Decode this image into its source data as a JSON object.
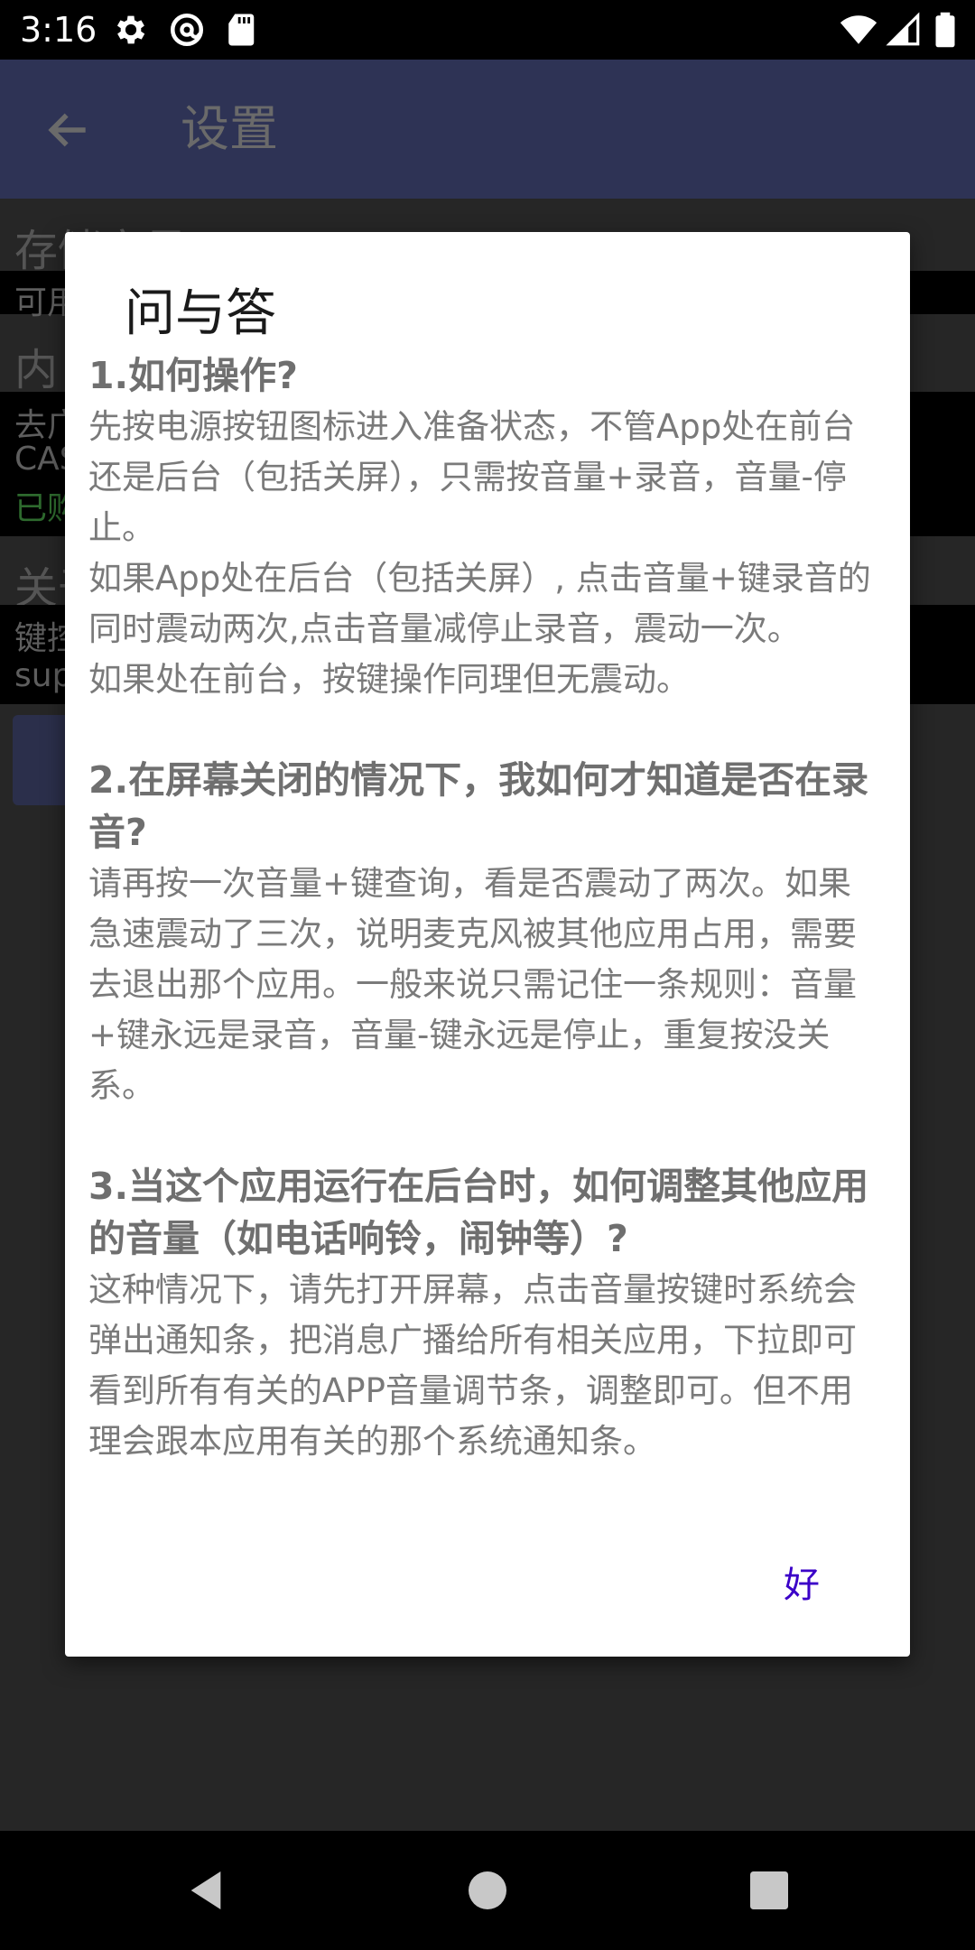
{
  "status_bar": {
    "time": "3:16",
    "icons": [
      "gear-icon",
      "at-sign-icon",
      "sd-card-icon",
      "wifi-icon",
      "cell-signal-icon",
      "battery-icon"
    ]
  },
  "app_bar": {
    "title": "设置",
    "color": "#2e3355"
  },
  "background_list": {
    "section_1": "存储容量",
    "section_1_line": "可用",
    "section_2": "内",
    "section_2_lines": [
      "去广",
      "CAS",
      "已购"
    ],
    "section_3": "关于",
    "section_3_lines": [
      "键控",
      "sup"
    ]
  },
  "dialog": {
    "title": "问与答",
    "qa": [
      {
        "q": "1.如何操作?",
        "a": "先按电源按钮图标进入准备状态，不管App处在前台还是后台（包括关屏），只需按音量+录音，音量-停止。\n如果App处在后台（包括关屏）, 点击音量+键录音的同时震动两次,点击音量减停止录音，震动一次。\n如果处在前台，按键操作同理但无震动。"
      },
      {
        "q": "2.在屏幕关闭的情况下，我如何才知道是否在录音?",
        "a": "请再按一次音量+键查询，看是否震动了两次。如果急速震动了三次，说明麦克风被其他应用占用，需要去退出那个应用。一般来说只需记住一条规则：音量+键永远是录音，音量-键永远是停止，重复按没关系。"
      },
      {
        "q": "3.当这个应用运行在后台时，如何调整其他应用的音量（如电话响铃，闹钟等）?",
        "a": "这种情况下，请先打开屏幕，点击音量按键时系统会弹出通知条，把消息广播给所有相关应用，下拉即可看到所有有关的APP音量调节条，调整即可。但不用理会跟本应用有关的那个系统通知条。"
      }
    ],
    "ok_label": "好",
    "accent": "#3b00c8"
  },
  "nav_bar": {
    "icons": [
      "back-triangle-icon",
      "home-circle-icon",
      "recents-square-icon"
    ]
  }
}
